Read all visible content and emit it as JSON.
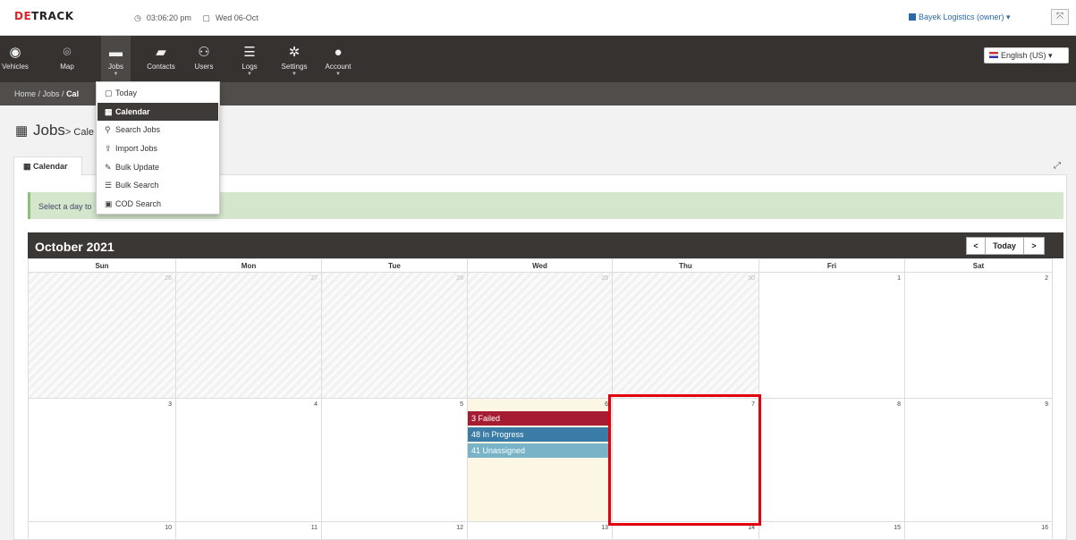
{
  "topbar": {
    "logo_part1": "DE",
    "logo_part2": "TRACK",
    "time": "03:06:20 pm",
    "date": "Wed 06-Oct",
    "company": "Bayek Logistics (owner) ▾"
  },
  "nav": {
    "items": [
      {
        "label": "Vehicles",
        "icon": "dashboard-icon"
      },
      {
        "label": "Map",
        "icon": "map-pin-icon"
      },
      {
        "label": "Jobs",
        "icon": "briefcase-icon"
      },
      {
        "label": "Contacts",
        "icon": "book-icon"
      },
      {
        "label": "Users",
        "icon": "users-icon"
      },
      {
        "label": "Logs",
        "icon": "list-icon"
      },
      {
        "label": "Settings",
        "icon": "gear-icon"
      },
      {
        "label": "Account",
        "icon": "user-icon"
      }
    ],
    "language": "English (US) ▾"
  },
  "breadcrumb": {
    "home": "Home",
    "sep1": " / ",
    "jobs": "Jobs",
    "sep2": " / ",
    "current": "Cal"
  },
  "page": {
    "title": "Jobs",
    "subtitle": "> Cale"
  },
  "tab": {
    "label": "Calendar"
  },
  "alert": {
    "text": "Select a day to"
  },
  "jobs_menu": {
    "items": [
      {
        "label": "Today",
        "icon": "calendar-icon"
      },
      {
        "label": "Calendar",
        "icon": "calendar-grid-icon"
      },
      {
        "label": "Search Jobs",
        "icon": "search-icon"
      },
      {
        "label": "Import Jobs",
        "icon": "upload-icon"
      },
      {
        "label": "Bulk Update",
        "icon": "edit-icon"
      },
      {
        "label": "Bulk Search",
        "icon": "list-icon"
      },
      {
        "label": "COD Search",
        "icon": "cash-icon"
      }
    ]
  },
  "calendar": {
    "month": "October 2021",
    "prev": "<",
    "today": "Today",
    "next": ">",
    "days": [
      "Sun",
      "Mon",
      "Tue",
      "Wed",
      "Thu",
      "Fri",
      "Sat"
    ],
    "weeks": [
      [
        "26",
        "27",
        "28",
        "29",
        "30",
        "1",
        "2"
      ],
      [
        "3",
        "4",
        "5",
        "6",
        "7",
        "8",
        "9"
      ],
      [
        "10",
        "11",
        "12",
        "13",
        "14",
        "15",
        "16"
      ]
    ],
    "events": {
      "failed": "3 Failed",
      "in_progress": "48 In Progress",
      "unassigned": "41 Unassigned"
    }
  }
}
